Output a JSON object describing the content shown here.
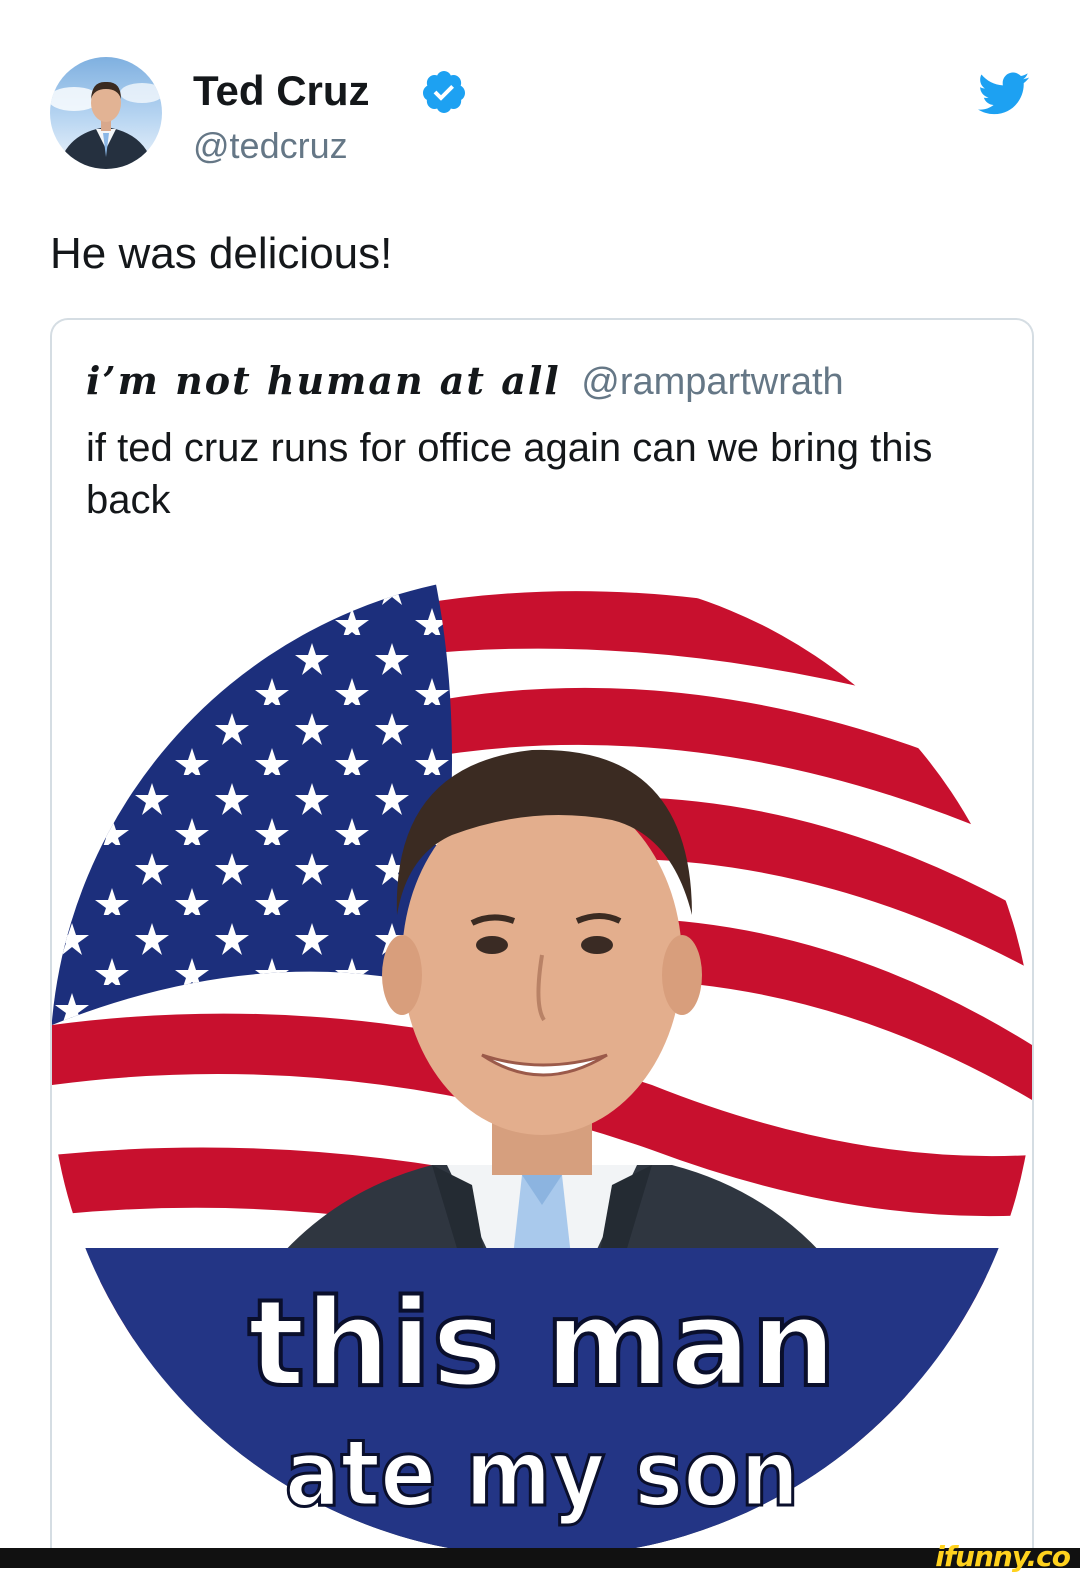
{
  "tweet": {
    "author_name": "Ted Cruz",
    "author_handle": "@tedcruz",
    "text": "He was delicious!"
  },
  "quoted_tweet": {
    "author_name": "i’m not human at all",
    "author_handle": "@rampartwrath",
    "text": "if ted cruz runs for office again can we bring this back",
    "image": {
      "banner_line1": "this man",
      "banner_line2": "ate my son"
    }
  },
  "watermark": "ifunny.co",
  "colors": {
    "verified_blue": "#1da1f2",
    "twitter_blue": "#1da1f2",
    "flag_red": "#c8102e",
    "flag_blue": "#1c2f7c",
    "banner_blue": "#233585"
  },
  "icons": [
    "verified-icon",
    "twitter-bird-icon"
  ]
}
